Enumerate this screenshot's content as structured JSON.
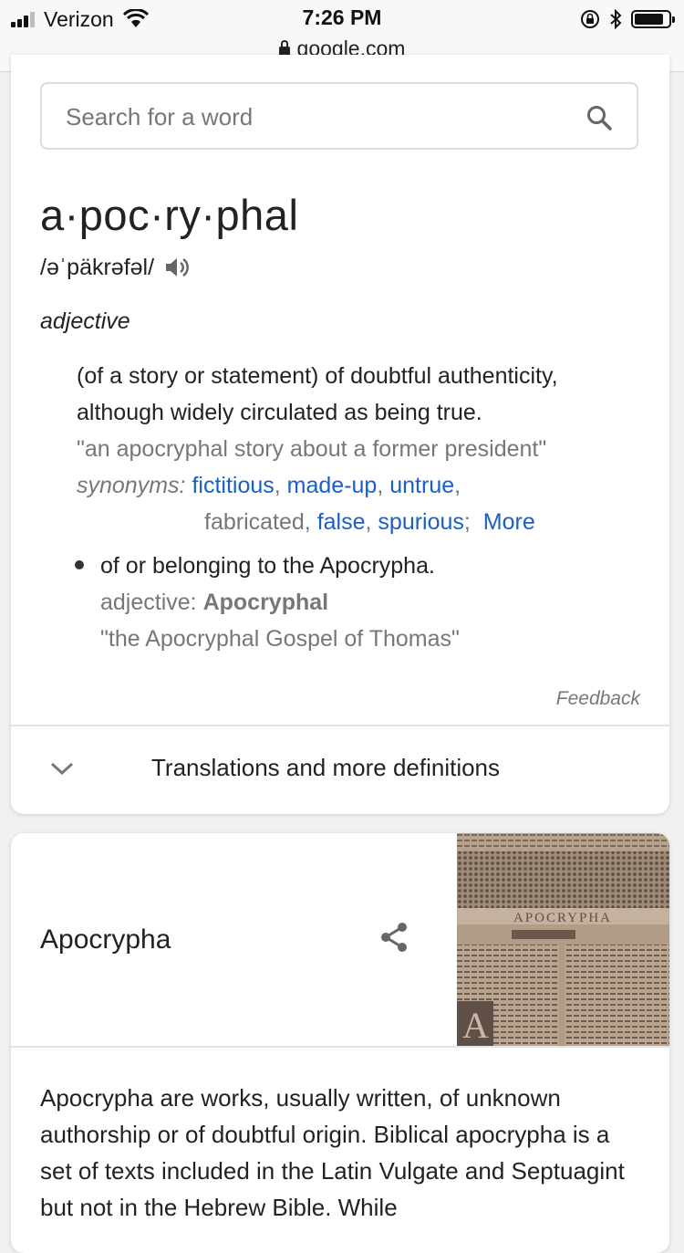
{
  "status_bar": {
    "carrier": "Verizon",
    "time": "7:26 PM",
    "url": "google.com",
    "battery_level": 0.85
  },
  "search": {
    "placeholder": "Search for a word"
  },
  "entry": {
    "word": "a·poc·ry·phal",
    "pronunciation": "/əˈpäkrəfəl/",
    "part_of_speech": "adjective",
    "definition_1": {
      "text": "(of a story or statement) of doubtful authenticity, although widely circulated as being true.",
      "example": "\"an apocryphal story about a former president\"",
      "synonyms_label": "synonyms:",
      "synonyms": [
        {
          "text": "fictitious",
          "link": true
        },
        {
          "text": "made-up",
          "link": true
        },
        {
          "text": "untrue",
          "link": true
        },
        {
          "text": "fabricated",
          "link": false
        },
        {
          "text": "false",
          "link": true
        },
        {
          "text": "spurious",
          "link": true
        }
      ],
      "more_label": "More"
    },
    "definition_2": {
      "text": "of or belonging to the Apocrypha.",
      "sub_label": "adjective:",
      "sub_value": "Apocryphal",
      "example": "\"the Apocryphal Gospel of Thomas\""
    }
  },
  "feedback_label": "Feedback",
  "more_definitions_label": "Translations and more definitions",
  "knowledge_panel": {
    "title": "Apocrypha",
    "image_text": "APOCRYPHA",
    "description": "Apocrypha are works, usually written, of unknown authorship or of doubtful origin. Biblical apocrypha is a set of texts included in the Latin Vulgate and Septuagint but not in the Hebrew Bible. While"
  },
  "colors": {
    "link": "#1a5fc7",
    "muted": "#777777",
    "text": "#222222"
  }
}
